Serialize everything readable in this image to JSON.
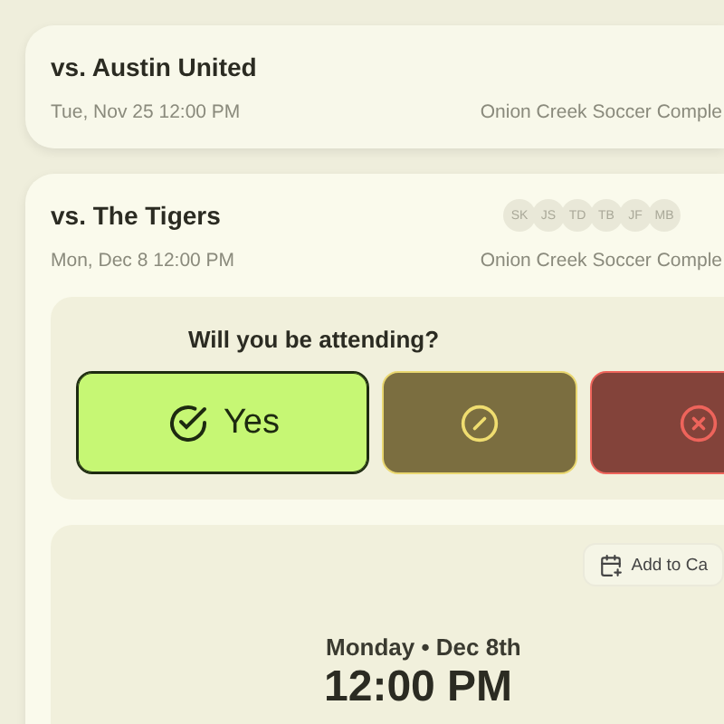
{
  "games": [
    {
      "title": "vs. Austin United",
      "datetime": "Tue, Nov 25 12:00 PM",
      "location": "Onion Creek Soccer Comple"
    },
    {
      "title": "vs. The Tigers",
      "datetime": "Mon, Dec 8 12:00 PM",
      "location": "Onion Creek Soccer Comple",
      "attendees": [
        "SK",
        "JS",
        "TD",
        "TB",
        "JF",
        "MB"
      ],
      "rsvp": {
        "question": "Will you be attending?",
        "options": [
          {
            "kind": "yes",
            "label": "Yes",
            "selected": true
          },
          {
            "kind": "maybe",
            "selected": false
          },
          {
            "kind": "no",
            "selected": false
          }
        ]
      },
      "calendar_button": "Add to Ca",
      "day": "Monday • Dec 8th",
      "time": "12:00 PM"
    }
  ]
}
